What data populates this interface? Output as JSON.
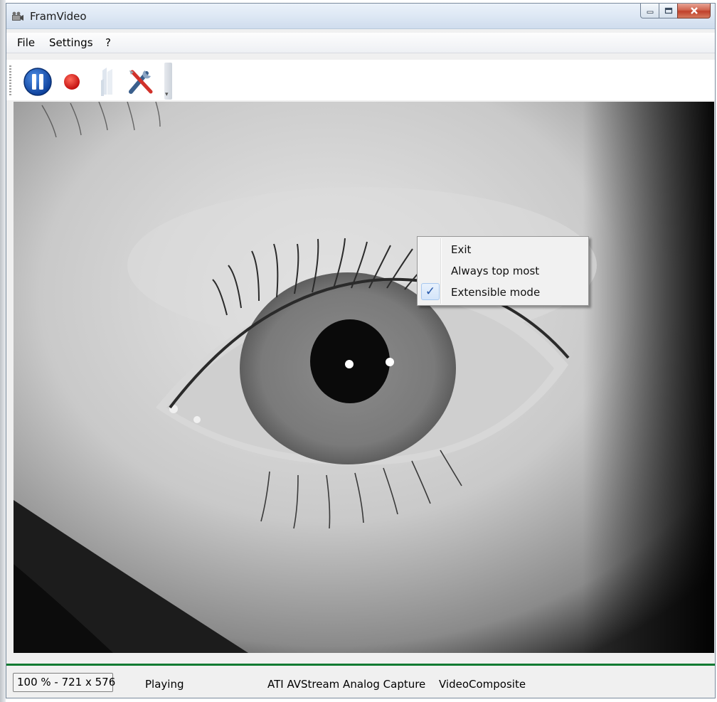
{
  "window": {
    "title": "FramVideo",
    "app_icon": "film-camera-icon",
    "caption_buttons": [
      "minimize-icon",
      "maximize-icon",
      "close-icon"
    ]
  },
  "menu": {
    "items": [
      "File",
      "Settings",
      "?"
    ]
  },
  "toolbar": {
    "buttons": [
      {
        "name": "pause-button",
        "icon": "pause-icon",
        "color": "#1a56b8"
      },
      {
        "name": "record-button",
        "icon": "record-icon",
        "color": "#d81e1e"
      },
      {
        "name": "snapshot-button",
        "icon": "snapshot-icon",
        "state": "disabled"
      },
      {
        "name": "settings-tools-button",
        "icon": "tools-icon",
        "color": "#c8322c"
      }
    ],
    "overflow_icon": "chevron-down-icon"
  },
  "video": {
    "content": "grayscale camera feed"
  },
  "context_menu": {
    "items": [
      {
        "label": "Exit",
        "checked": false
      },
      {
        "label": "Always top most",
        "checked": false
      },
      {
        "label": "Extensible mode",
        "checked": true
      }
    ],
    "check_glyph": "✓"
  },
  "statusbar": {
    "zoom_info": "100 % - 721 x 576",
    "state": "Playing",
    "device": "ATI AVStream Analog Capture",
    "input": "VideoComposite"
  },
  "colors": {
    "status_line": "#0f7a32",
    "close_button": "#c8452f"
  }
}
